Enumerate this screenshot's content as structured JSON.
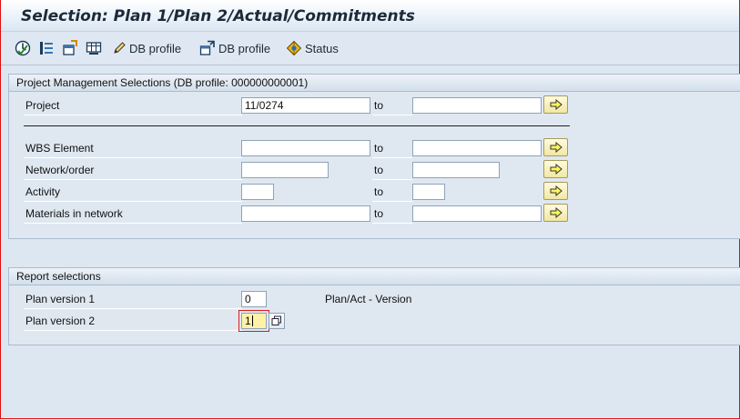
{
  "window": {
    "title": "Selection: Plan 1/Plan 2/Actual/Commitments"
  },
  "toolbar": {
    "items": [
      {
        "icon": "execute-icon",
        "label": ""
      },
      {
        "icon": "selection-options-icon",
        "label": ""
      },
      {
        "icon": "dynamic-selections-icon",
        "label": ""
      },
      {
        "icon": "layout-icon",
        "label": ""
      },
      {
        "icon": "pencil-icon",
        "label": "DB profile"
      },
      {
        "icon": "db-profile-icon",
        "label": "DB profile"
      },
      {
        "icon": "status-icon",
        "label": "Status"
      }
    ]
  },
  "pm_group": {
    "title": "Project Management Selections (DB profile: 000000000001)",
    "rows": [
      {
        "label": "Project",
        "from": "11/0274",
        "to_label": "to",
        "to": ""
      },
      {
        "label": "WBS Element",
        "from": "",
        "to_label": "to",
        "to": ""
      },
      {
        "label": "Network/order",
        "from": "",
        "to_label": "to",
        "to": ""
      },
      {
        "label": "Activity",
        "from": "",
        "to_label": "to",
        "to": ""
      },
      {
        "label": "Materials in network",
        "from": "",
        "to_label": "to",
        "to": ""
      }
    ]
  },
  "report_group": {
    "title": "Report selections",
    "rows": [
      {
        "label": "Plan version 1",
        "value": "0",
        "hint": "Plan/Act - Version"
      },
      {
        "label": "Plan version 2",
        "value": "1",
        "hint": ""
      }
    ]
  },
  "colors": {
    "background": "#dfe8f2",
    "frame_border": "#e01010",
    "arrow_button": "#f5eca8",
    "active_field": "#fff2a8"
  }
}
